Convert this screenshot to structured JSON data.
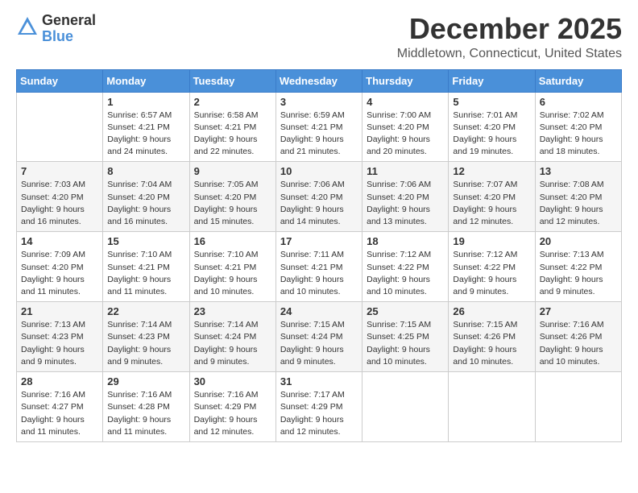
{
  "logo": {
    "general": "General",
    "blue": "Blue"
  },
  "header": {
    "month": "December 2025",
    "location": "Middletown, Connecticut, United States"
  },
  "weekdays": [
    "Sunday",
    "Monday",
    "Tuesday",
    "Wednesday",
    "Thursday",
    "Friday",
    "Saturday"
  ],
  "weeks": [
    [
      {
        "day": "",
        "sunrise": "",
        "sunset": "",
        "daylight": ""
      },
      {
        "day": "1",
        "sunrise": "Sunrise: 6:57 AM",
        "sunset": "Sunset: 4:21 PM",
        "daylight": "Daylight: 9 hours and 24 minutes."
      },
      {
        "day": "2",
        "sunrise": "Sunrise: 6:58 AM",
        "sunset": "Sunset: 4:21 PM",
        "daylight": "Daylight: 9 hours and 22 minutes."
      },
      {
        "day": "3",
        "sunrise": "Sunrise: 6:59 AM",
        "sunset": "Sunset: 4:21 PM",
        "daylight": "Daylight: 9 hours and 21 minutes."
      },
      {
        "day": "4",
        "sunrise": "Sunrise: 7:00 AM",
        "sunset": "Sunset: 4:20 PM",
        "daylight": "Daylight: 9 hours and 20 minutes."
      },
      {
        "day": "5",
        "sunrise": "Sunrise: 7:01 AM",
        "sunset": "Sunset: 4:20 PM",
        "daylight": "Daylight: 9 hours and 19 minutes."
      },
      {
        "day": "6",
        "sunrise": "Sunrise: 7:02 AM",
        "sunset": "Sunset: 4:20 PM",
        "daylight": "Daylight: 9 hours and 18 minutes."
      }
    ],
    [
      {
        "day": "7",
        "sunrise": "Sunrise: 7:03 AM",
        "sunset": "Sunset: 4:20 PM",
        "daylight": "Daylight: 9 hours and 16 minutes."
      },
      {
        "day": "8",
        "sunrise": "Sunrise: 7:04 AM",
        "sunset": "Sunset: 4:20 PM",
        "daylight": "Daylight: 9 hours and 16 minutes."
      },
      {
        "day": "9",
        "sunrise": "Sunrise: 7:05 AM",
        "sunset": "Sunset: 4:20 PM",
        "daylight": "Daylight: 9 hours and 15 minutes."
      },
      {
        "day": "10",
        "sunrise": "Sunrise: 7:06 AM",
        "sunset": "Sunset: 4:20 PM",
        "daylight": "Daylight: 9 hours and 14 minutes."
      },
      {
        "day": "11",
        "sunrise": "Sunrise: 7:06 AM",
        "sunset": "Sunset: 4:20 PM",
        "daylight": "Daylight: 9 hours and 13 minutes."
      },
      {
        "day": "12",
        "sunrise": "Sunrise: 7:07 AM",
        "sunset": "Sunset: 4:20 PM",
        "daylight": "Daylight: 9 hours and 12 minutes."
      },
      {
        "day": "13",
        "sunrise": "Sunrise: 7:08 AM",
        "sunset": "Sunset: 4:20 PM",
        "daylight": "Daylight: 9 hours and 12 minutes."
      }
    ],
    [
      {
        "day": "14",
        "sunrise": "Sunrise: 7:09 AM",
        "sunset": "Sunset: 4:20 PM",
        "daylight": "Daylight: 9 hours and 11 minutes."
      },
      {
        "day": "15",
        "sunrise": "Sunrise: 7:10 AM",
        "sunset": "Sunset: 4:21 PM",
        "daylight": "Daylight: 9 hours and 11 minutes."
      },
      {
        "day": "16",
        "sunrise": "Sunrise: 7:10 AM",
        "sunset": "Sunset: 4:21 PM",
        "daylight": "Daylight: 9 hours and 10 minutes."
      },
      {
        "day": "17",
        "sunrise": "Sunrise: 7:11 AM",
        "sunset": "Sunset: 4:21 PM",
        "daylight": "Daylight: 9 hours and 10 minutes."
      },
      {
        "day": "18",
        "sunrise": "Sunrise: 7:12 AM",
        "sunset": "Sunset: 4:22 PM",
        "daylight": "Daylight: 9 hours and 10 minutes."
      },
      {
        "day": "19",
        "sunrise": "Sunrise: 7:12 AM",
        "sunset": "Sunset: 4:22 PM",
        "daylight": "Daylight: 9 hours and 9 minutes."
      },
      {
        "day": "20",
        "sunrise": "Sunrise: 7:13 AM",
        "sunset": "Sunset: 4:22 PM",
        "daylight": "Daylight: 9 hours and 9 minutes."
      }
    ],
    [
      {
        "day": "21",
        "sunrise": "Sunrise: 7:13 AM",
        "sunset": "Sunset: 4:23 PM",
        "daylight": "Daylight: 9 hours and 9 minutes."
      },
      {
        "day": "22",
        "sunrise": "Sunrise: 7:14 AM",
        "sunset": "Sunset: 4:23 PM",
        "daylight": "Daylight: 9 hours and 9 minutes."
      },
      {
        "day": "23",
        "sunrise": "Sunrise: 7:14 AM",
        "sunset": "Sunset: 4:24 PM",
        "daylight": "Daylight: 9 hours and 9 minutes."
      },
      {
        "day": "24",
        "sunrise": "Sunrise: 7:15 AM",
        "sunset": "Sunset: 4:24 PM",
        "daylight": "Daylight: 9 hours and 9 minutes."
      },
      {
        "day": "25",
        "sunrise": "Sunrise: 7:15 AM",
        "sunset": "Sunset: 4:25 PM",
        "daylight": "Daylight: 9 hours and 10 minutes."
      },
      {
        "day": "26",
        "sunrise": "Sunrise: 7:15 AM",
        "sunset": "Sunset: 4:26 PM",
        "daylight": "Daylight: 9 hours and 10 minutes."
      },
      {
        "day": "27",
        "sunrise": "Sunrise: 7:16 AM",
        "sunset": "Sunset: 4:26 PM",
        "daylight": "Daylight: 9 hours and 10 minutes."
      }
    ],
    [
      {
        "day": "28",
        "sunrise": "Sunrise: 7:16 AM",
        "sunset": "Sunset: 4:27 PM",
        "daylight": "Daylight: 9 hours and 11 minutes."
      },
      {
        "day": "29",
        "sunrise": "Sunrise: 7:16 AM",
        "sunset": "Sunset: 4:28 PM",
        "daylight": "Daylight: 9 hours and 11 minutes."
      },
      {
        "day": "30",
        "sunrise": "Sunrise: 7:16 AM",
        "sunset": "Sunset: 4:29 PM",
        "daylight": "Daylight: 9 hours and 12 minutes."
      },
      {
        "day": "31",
        "sunrise": "Sunrise: 7:17 AM",
        "sunset": "Sunset: 4:29 PM",
        "daylight": "Daylight: 9 hours and 12 minutes."
      },
      {
        "day": "",
        "sunrise": "",
        "sunset": "",
        "daylight": ""
      },
      {
        "day": "",
        "sunrise": "",
        "sunset": "",
        "daylight": ""
      },
      {
        "day": "",
        "sunrise": "",
        "sunset": "",
        "daylight": ""
      }
    ]
  ]
}
